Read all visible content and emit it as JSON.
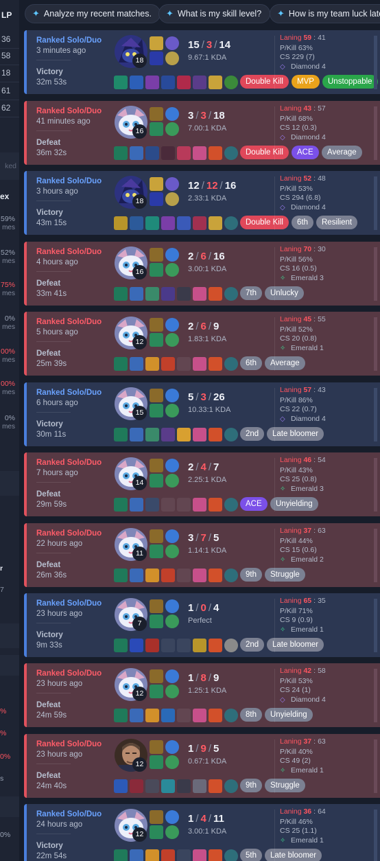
{
  "left_column": {
    "header": "LP",
    "lp_values": [
      "36",
      "58",
      "18",
      "61",
      "62"
    ],
    "muted_fragment": "ked",
    "index_fragment": "ex",
    "stats": [
      {
        "pct": "59%",
        "games": "mes",
        "color": "#9aa3b5"
      },
      {
        "pct": "52%",
        "games": "mes",
        "color": "#9aa3b5"
      },
      {
        "pct": "75%",
        "games": "mes",
        "color": "#ff5560"
      },
      {
        "pct": "0%",
        "games": "mes",
        "color": "#9aa3b5"
      },
      {
        "pct": "00%",
        "games": "mes",
        "color": "#ff5560"
      },
      {
        "pct": "00%",
        "games": "mes",
        "color": "#ff5560"
      },
      {
        "pct": "0%",
        "games": "mes",
        "color": "#9aa3b5"
      }
    ],
    "frag_r": "r",
    "frag_7": "7",
    "lower_pcts": [
      {
        "pct": "%",
        "color": "#ff5560"
      },
      {
        "pct": "%",
        "color": "#ff5560"
      },
      {
        "pct": "0%",
        "color": "#ff5560"
      },
      {
        "pct": "s",
        "color": "#9aa3b5"
      },
      {
        "pct": "0%",
        "color": "#9aa3b5"
      }
    ]
  },
  "prompts": [
    {
      "label": "Analyze my recent matches."
    },
    {
      "label": "What is my skill level?"
    },
    {
      "label": "How is my team luck latel"
    }
  ],
  "matches": [
    {
      "queue": "Ranked Solo/Duo",
      "ago": "3 minutes ago",
      "result": "Victory",
      "duration": "32m 53s",
      "win": true,
      "champion": "veigar-icon",
      "level": "18",
      "kills": "15",
      "deaths": "3",
      "assists": "14",
      "kda": "9.67:1 KDA",
      "laning_label": "Laning",
      "laning": "59",
      "laning_opp": "41",
      "pkill": "P/Kill 63%",
      "cs": "CS 229 (7)",
      "rank": "Diamond 4",
      "rank_tier": "diamond",
      "badges": [
        {
          "text": "Double Kill",
          "color": "red"
        },
        {
          "text": "MVP",
          "color": "orange"
        },
        {
          "text": "Unstoppable",
          "color": "green"
        }
      ]
    },
    {
      "queue": "Ranked Solo/Duo",
      "ago": "41 minutes ago",
      "result": "Defeat",
      "duration": "36m 32s",
      "win": false,
      "champion": "yuumi-icon",
      "level": "16",
      "kills": "3",
      "deaths": "3",
      "assists": "18",
      "kda": "7.00:1 KDA",
      "laning_label": "Laning",
      "laning": "43",
      "laning_opp": "57",
      "pkill": "P/Kill 68%",
      "cs": "CS 12 (0.3)",
      "rank": "Diamond 4",
      "rank_tier": "diamond",
      "badges": [
        {
          "text": "Double Kill",
          "color": "red"
        },
        {
          "text": "ACE",
          "color": "purple"
        },
        {
          "text": "Average",
          "color": "gray"
        }
      ]
    },
    {
      "queue": "Ranked Solo/Duo",
      "ago": "3 hours ago",
      "result": "Victory",
      "duration": "43m 15s",
      "win": true,
      "champion": "veigar-icon",
      "level": "18",
      "kills": "12",
      "deaths": "12",
      "assists": "16",
      "kda": "2.33:1 KDA",
      "laning_label": "Laning",
      "laning": "52",
      "laning_opp": "48",
      "pkill": "P/Kill 53%",
      "cs": "CS 294 (6.8)",
      "rank": "Diamond 4",
      "rank_tier": "diamond",
      "badges": [
        {
          "text": "Double Kill",
          "color": "red"
        },
        {
          "text": "6th",
          "color": "gray"
        },
        {
          "text": "Resilient",
          "color": "gray"
        }
      ]
    },
    {
      "queue": "Ranked Solo/Duo",
      "ago": "4 hours ago",
      "result": "Defeat",
      "duration": "33m 41s",
      "win": false,
      "champion": "yuumi-icon",
      "level": "16",
      "kills": "2",
      "deaths": "6",
      "assists": "16",
      "kda": "3.00:1 KDA",
      "laning_label": "Laning",
      "laning": "70",
      "laning_opp": "30",
      "pkill": "P/Kill 56%",
      "cs": "CS 16 (0.5)",
      "rank": "Emerald 3",
      "rank_tier": "emerald",
      "badges": [
        {
          "text": "7th",
          "color": "gray"
        },
        {
          "text": "Unlucky",
          "color": "gray"
        }
      ]
    },
    {
      "queue": "Ranked Solo/Duo",
      "ago": "5 hours ago",
      "result": "Defeat",
      "duration": "25m 39s",
      "win": false,
      "champion": "yuumi-icon",
      "level": "12",
      "kills": "2",
      "deaths": "6",
      "assists": "9",
      "kda": "1.83:1 KDA",
      "laning_label": "Laning",
      "laning": "45",
      "laning_opp": "55",
      "pkill": "P/Kill 52%",
      "cs": "CS 20 (0.8)",
      "rank": "Emerald 1",
      "rank_tier": "emerald",
      "badges": [
        {
          "text": "6th",
          "color": "gray"
        },
        {
          "text": "Average",
          "color": "gray"
        }
      ]
    },
    {
      "queue": "Ranked Solo/Duo",
      "ago": "6 hours ago",
      "result": "Victory",
      "duration": "30m 11s",
      "win": true,
      "champion": "yuumi-icon",
      "level": "15",
      "kills": "5",
      "deaths": "3",
      "assists": "26",
      "kda": "10.33:1 KDA",
      "laning_label": "Laning",
      "laning": "57",
      "laning_opp": "43",
      "pkill": "P/Kill 86%",
      "cs": "CS 22 (0.7)",
      "rank": "Diamond 4",
      "rank_tier": "diamond",
      "badges": [
        {
          "text": "2nd",
          "color": "gray"
        },
        {
          "text": "Late bloomer",
          "color": "gray"
        }
      ]
    },
    {
      "queue": "Ranked Solo/Duo",
      "ago": "7 hours ago",
      "result": "Defeat",
      "duration": "29m 59s",
      "win": false,
      "champion": "yuumi-icon",
      "level": "14",
      "kills": "2",
      "deaths": "4",
      "assists": "7",
      "kda": "2.25:1 KDA",
      "laning_label": "Laning",
      "laning": "46",
      "laning_opp": "54",
      "pkill": "P/Kill 43%",
      "cs": "CS 25 (0.8)",
      "rank": "Emerald 3",
      "rank_tier": "emerald",
      "badges": [
        {
          "text": "ACE",
          "color": "purple"
        },
        {
          "text": "Unyielding",
          "color": "gray"
        }
      ]
    },
    {
      "queue": "Ranked Solo/Duo",
      "ago": "22 hours ago",
      "result": "Defeat",
      "duration": "26m 36s",
      "win": false,
      "champion": "yuumi-icon",
      "level": "11",
      "kills": "3",
      "deaths": "7",
      "assists": "5",
      "kda": "1.14:1 KDA",
      "laning_label": "Laning",
      "laning": "37",
      "laning_opp": "63",
      "pkill": "P/Kill 44%",
      "cs": "CS 15 (0.6)",
      "rank": "Emerald 2",
      "rank_tier": "emerald",
      "badges": [
        {
          "text": "9th",
          "color": "gray"
        },
        {
          "text": "Struggle",
          "color": "gray"
        }
      ]
    },
    {
      "queue": "Ranked Solo/Duo",
      "ago": "23 hours ago",
      "result": "Victory",
      "duration": "9m 33s",
      "win": true,
      "champion": "yuumi-icon",
      "level": "7",
      "kills": "1",
      "deaths": "0",
      "assists": "4",
      "kda": "Perfect",
      "laning_label": "Laning",
      "laning": "65",
      "laning_opp": "35",
      "pkill": "P/Kill 71%",
      "cs": "CS 9 (0.9)",
      "rank": "Emerald 1",
      "rank_tier": "emerald",
      "badges": [
        {
          "text": "2nd",
          "color": "gray"
        },
        {
          "text": "Late bloomer",
          "color": "gray"
        }
      ]
    },
    {
      "queue": "Ranked Solo/Duo",
      "ago": "23 hours ago",
      "result": "Defeat",
      "duration": "24m 59s",
      "win": false,
      "champion": "yuumi-icon",
      "level": "12",
      "kills": "1",
      "deaths": "8",
      "assists": "9",
      "kda": "1.25:1 KDA",
      "laning_label": "Laning",
      "laning": "42",
      "laning_opp": "58",
      "pkill": "P/Kill 53%",
      "cs": "CS 24 (1)",
      "rank": "Diamond 4",
      "rank_tier": "diamond",
      "badges": [
        {
          "text": "8th",
          "color": "gray"
        },
        {
          "text": "Unyielding",
          "color": "gray"
        }
      ]
    },
    {
      "queue": "Ranked Solo/Duo",
      "ago": "23 hours ago",
      "result": "Defeat",
      "duration": "24m 40s",
      "win": false,
      "champion": "swain-icon",
      "level": "12",
      "kills": "1",
      "deaths": "9",
      "assists": "5",
      "kda": "0.67:1 KDA",
      "laning_label": "Laning",
      "laning": "37",
      "laning_opp": "63",
      "pkill": "P/Kill 40%",
      "cs": "CS 49 (2)",
      "rank": "Emerald 1",
      "rank_tier": "emerald",
      "badges": [
        {
          "text": "9th",
          "color": "gray"
        },
        {
          "text": "Struggle",
          "color": "gray"
        }
      ]
    },
    {
      "queue": "Ranked Solo/Duo",
      "ago": "24 hours ago",
      "result": "Victory",
      "duration": "22m 54s",
      "win": true,
      "champion": "yuumi-icon",
      "level": "12",
      "kills": "1",
      "deaths": "4",
      "assists": "11",
      "kda": "3.00:1 KDA",
      "laning_label": "Laning",
      "laning": "36",
      "laning_opp": "64",
      "pkill": "P/Kill 46%",
      "cs": "CS 25 (1.1)",
      "rank": "Emerald 1",
      "rank_tier": "emerald",
      "badges": [
        {
          "text": "5th",
          "color": "gray"
        },
        {
          "text": "Late bloomer",
          "color": "gray"
        }
      ]
    }
  ]
}
